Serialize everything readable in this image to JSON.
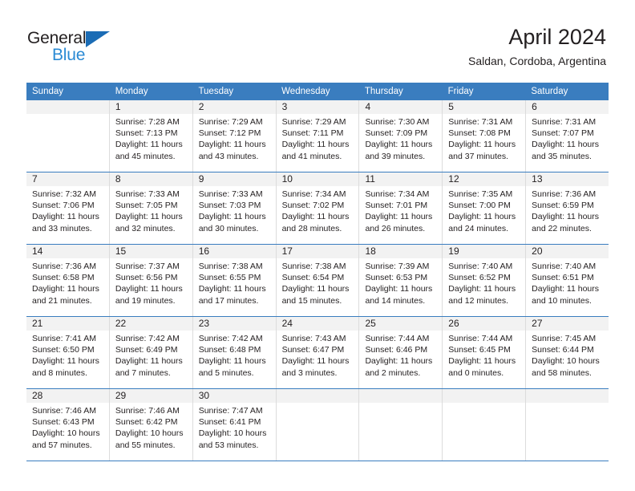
{
  "logo": {
    "line1": "General",
    "line2": "Blue",
    "triangle_icon": "triangle-icon",
    "color_dark": "#231f20",
    "color_blue": "#2a8ad4",
    "color_triangle": "#1b6cb5"
  },
  "header": {
    "title": "April 2024",
    "subtitle": "Saldan, Cordoba, Argentina"
  },
  "theme": {
    "header_bg": "#3a7dbf",
    "header_text": "#ffffff",
    "daynum_bg": "#f2f2f2",
    "cell_border": "#dcdcdc",
    "row_divider": "#3a7dbf"
  },
  "weekdays": [
    "Sunday",
    "Monday",
    "Tuesday",
    "Wednesday",
    "Thursday",
    "Friday",
    "Saturday"
  ],
  "weeks": [
    [
      {
        "day": "",
        "sunrise": "",
        "sunset": "",
        "daylight_line1": "",
        "daylight_line2": ""
      },
      {
        "day": "1",
        "sunrise": "Sunrise: 7:28 AM",
        "sunset": "Sunset: 7:13 PM",
        "daylight_line1": "Daylight: 11 hours",
        "daylight_line2": "and 45 minutes."
      },
      {
        "day": "2",
        "sunrise": "Sunrise: 7:29 AM",
        "sunset": "Sunset: 7:12 PM",
        "daylight_line1": "Daylight: 11 hours",
        "daylight_line2": "and 43 minutes."
      },
      {
        "day": "3",
        "sunrise": "Sunrise: 7:29 AM",
        "sunset": "Sunset: 7:11 PM",
        "daylight_line1": "Daylight: 11 hours",
        "daylight_line2": "and 41 minutes."
      },
      {
        "day": "4",
        "sunrise": "Sunrise: 7:30 AM",
        "sunset": "Sunset: 7:09 PM",
        "daylight_line1": "Daylight: 11 hours",
        "daylight_line2": "and 39 minutes."
      },
      {
        "day": "5",
        "sunrise": "Sunrise: 7:31 AM",
        "sunset": "Sunset: 7:08 PM",
        "daylight_line1": "Daylight: 11 hours",
        "daylight_line2": "and 37 minutes."
      },
      {
        "day": "6",
        "sunrise": "Sunrise: 7:31 AM",
        "sunset": "Sunset: 7:07 PM",
        "daylight_line1": "Daylight: 11 hours",
        "daylight_line2": "and 35 minutes."
      }
    ],
    [
      {
        "day": "7",
        "sunrise": "Sunrise: 7:32 AM",
        "sunset": "Sunset: 7:06 PM",
        "daylight_line1": "Daylight: 11 hours",
        "daylight_line2": "and 33 minutes."
      },
      {
        "day": "8",
        "sunrise": "Sunrise: 7:33 AM",
        "sunset": "Sunset: 7:05 PM",
        "daylight_line1": "Daylight: 11 hours",
        "daylight_line2": "and 32 minutes."
      },
      {
        "day": "9",
        "sunrise": "Sunrise: 7:33 AM",
        "sunset": "Sunset: 7:03 PM",
        "daylight_line1": "Daylight: 11 hours",
        "daylight_line2": "and 30 minutes."
      },
      {
        "day": "10",
        "sunrise": "Sunrise: 7:34 AM",
        "sunset": "Sunset: 7:02 PM",
        "daylight_line1": "Daylight: 11 hours",
        "daylight_line2": "and 28 minutes."
      },
      {
        "day": "11",
        "sunrise": "Sunrise: 7:34 AM",
        "sunset": "Sunset: 7:01 PM",
        "daylight_line1": "Daylight: 11 hours",
        "daylight_line2": "and 26 minutes."
      },
      {
        "day": "12",
        "sunrise": "Sunrise: 7:35 AM",
        "sunset": "Sunset: 7:00 PM",
        "daylight_line1": "Daylight: 11 hours",
        "daylight_line2": "and 24 minutes."
      },
      {
        "day": "13",
        "sunrise": "Sunrise: 7:36 AM",
        "sunset": "Sunset: 6:59 PM",
        "daylight_line1": "Daylight: 11 hours",
        "daylight_line2": "and 22 minutes."
      }
    ],
    [
      {
        "day": "14",
        "sunrise": "Sunrise: 7:36 AM",
        "sunset": "Sunset: 6:58 PM",
        "daylight_line1": "Daylight: 11 hours",
        "daylight_line2": "and 21 minutes."
      },
      {
        "day": "15",
        "sunrise": "Sunrise: 7:37 AM",
        "sunset": "Sunset: 6:56 PM",
        "daylight_line1": "Daylight: 11 hours",
        "daylight_line2": "and 19 minutes."
      },
      {
        "day": "16",
        "sunrise": "Sunrise: 7:38 AM",
        "sunset": "Sunset: 6:55 PM",
        "daylight_line1": "Daylight: 11 hours",
        "daylight_line2": "and 17 minutes."
      },
      {
        "day": "17",
        "sunrise": "Sunrise: 7:38 AM",
        "sunset": "Sunset: 6:54 PM",
        "daylight_line1": "Daylight: 11 hours",
        "daylight_line2": "and 15 minutes."
      },
      {
        "day": "18",
        "sunrise": "Sunrise: 7:39 AM",
        "sunset": "Sunset: 6:53 PM",
        "daylight_line1": "Daylight: 11 hours",
        "daylight_line2": "and 14 minutes."
      },
      {
        "day": "19",
        "sunrise": "Sunrise: 7:40 AM",
        "sunset": "Sunset: 6:52 PM",
        "daylight_line1": "Daylight: 11 hours",
        "daylight_line2": "and 12 minutes."
      },
      {
        "day": "20",
        "sunrise": "Sunrise: 7:40 AM",
        "sunset": "Sunset: 6:51 PM",
        "daylight_line1": "Daylight: 11 hours",
        "daylight_line2": "and 10 minutes."
      }
    ],
    [
      {
        "day": "21",
        "sunrise": "Sunrise: 7:41 AM",
        "sunset": "Sunset: 6:50 PM",
        "daylight_line1": "Daylight: 11 hours",
        "daylight_line2": "and 8 minutes."
      },
      {
        "day": "22",
        "sunrise": "Sunrise: 7:42 AM",
        "sunset": "Sunset: 6:49 PM",
        "daylight_line1": "Daylight: 11 hours",
        "daylight_line2": "and 7 minutes."
      },
      {
        "day": "23",
        "sunrise": "Sunrise: 7:42 AM",
        "sunset": "Sunset: 6:48 PM",
        "daylight_line1": "Daylight: 11 hours",
        "daylight_line2": "and 5 minutes."
      },
      {
        "day": "24",
        "sunrise": "Sunrise: 7:43 AM",
        "sunset": "Sunset: 6:47 PM",
        "daylight_line1": "Daylight: 11 hours",
        "daylight_line2": "and 3 minutes."
      },
      {
        "day": "25",
        "sunrise": "Sunrise: 7:44 AM",
        "sunset": "Sunset: 6:46 PM",
        "daylight_line1": "Daylight: 11 hours",
        "daylight_line2": "and 2 minutes."
      },
      {
        "day": "26",
        "sunrise": "Sunrise: 7:44 AM",
        "sunset": "Sunset: 6:45 PM",
        "daylight_line1": "Daylight: 11 hours",
        "daylight_line2": "and 0 minutes."
      },
      {
        "day": "27",
        "sunrise": "Sunrise: 7:45 AM",
        "sunset": "Sunset: 6:44 PM",
        "daylight_line1": "Daylight: 10 hours",
        "daylight_line2": "and 58 minutes."
      }
    ],
    [
      {
        "day": "28",
        "sunrise": "Sunrise: 7:46 AM",
        "sunset": "Sunset: 6:43 PM",
        "daylight_line1": "Daylight: 10 hours",
        "daylight_line2": "and 57 minutes."
      },
      {
        "day": "29",
        "sunrise": "Sunrise: 7:46 AM",
        "sunset": "Sunset: 6:42 PM",
        "daylight_line1": "Daylight: 10 hours",
        "daylight_line2": "and 55 minutes."
      },
      {
        "day": "30",
        "sunrise": "Sunrise: 7:47 AM",
        "sunset": "Sunset: 6:41 PM",
        "daylight_line1": "Daylight: 10 hours",
        "daylight_line2": "and 53 minutes."
      },
      {
        "day": "",
        "sunrise": "",
        "sunset": "",
        "daylight_line1": "",
        "daylight_line2": ""
      },
      {
        "day": "",
        "sunrise": "",
        "sunset": "",
        "daylight_line1": "",
        "daylight_line2": ""
      },
      {
        "day": "",
        "sunrise": "",
        "sunset": "",
        "daylight_line1": "",
        "daylight_line2": ""
      },
      {
        "day": "",
        "sunrise": "",
        "sunset": "",
        "daylight_line1": "",
        "daylight_line2": ""
      }
    ]
  ]
}
